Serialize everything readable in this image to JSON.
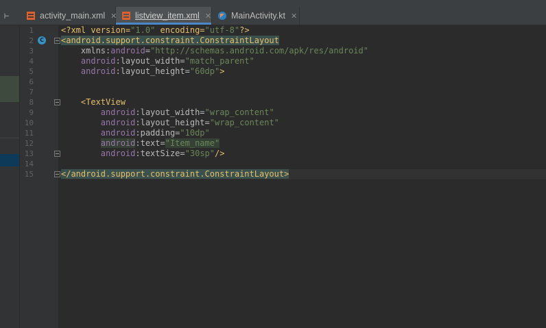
{
  "tabs": [
    {
      "label": "activity_main.xml",
      "icon": "xml-file-icon",
      "active": false
    },
    {
      "label": "listview_item.xml",
      "icon": "xml-file-icon",
      "active": true
    },
    {
      "label": "MainActivity.kt",
      "icon": "kotlin-file-icon",
      "active": false
    }
  ],
  "line_numbers": [
    "1",
    "2",
    "3",
    "4",
    "5",
    "6",
    "7",
    "8",
    "9",
    "10",
    "11",
    "12",
    "13",
    "14",
    "15"
  ],
  "code": {
    "l1": {
      "a": "<?xml version=",
      "b": "\"1.0\"",
      "c": " encoding=",
      "d": "\"utf-8\"",
      "e": "?>"
    },
    "l2": {
      "tag": "<android.support.constraint.ConstraintLayout"
    },
    "l3": {
      "ns": "xmlns:",
      "attr": "android",
      "eq": "=",
      "val": "\"http://schemas.android.com/apk/res/android\""
    },
    "l4": {
      "ns": "android",
      "attr": ":layout_width",
      "eq": "=",
      "val": "\"match_parent\""
    },
    "l5": {
      "ns": "android",
      "attr": ":layout_height",
      "eq": "=",
      "val": "\"60dp\"",
      "end": ">"
    },
    "l8": {
      "tag": "<TextView"
    },
    "l9": {
      "ns": "android",
      "attr": ":layout_width",
      "eq": "=",
      "val": "\"wrap_content\""
    },
    "l10": {
      "ns": "android",
      "attr": ":layout_height",
      "eq": "=",
      "val": "\"wrap_content\""
    },
    "l11": {
      "ns": "android",
      "attr": ":padding",
      "eq": "=",
      "val": "\"10dp\""
    },
    "l12": {
      "ns": "android",
      "attr": ":text",
      "eq": "=",
      "val": "\"Item_name\""
    },
    "l13": {
      "ns": "android",
      "attr": ":textSize",
      "eq": "=",
      "val": "\"30sp\"",
      "end": "/>"
    },
    "l15": {
      "tag": "</android.support.constraint.ConstraintLayout>"
    }
  },
  "colors": {
    "tag": "#e8bf6a",
    "string": "#6a8759",
    "namespace": "#9876aa",
    "accent": "#4a88c7"
  }
}
